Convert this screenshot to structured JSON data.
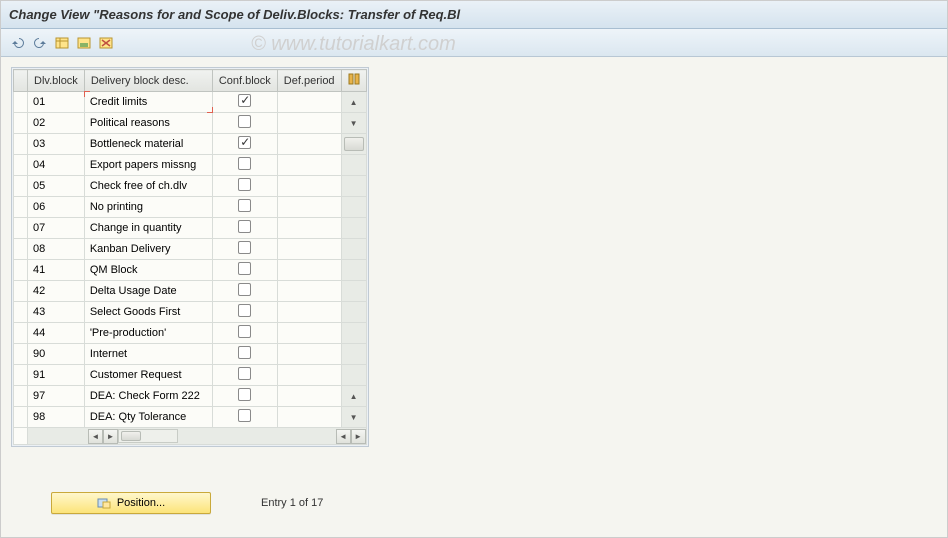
{
  "title": "Change View \"Reasons for and Scope of Deliv.Blocks: Transfer of Req.Bl",
  "watermark": "© www.tutorialkart.com",
  "toolbar": {
    "icons": [
      "undo-icon",
      "redo-icon",
      "table-new-icon",
      "table-save-icon",
      "table-delete-icon"
    ]
  },
  "columns": {
    "dlv": "Dlv.block",
    "desc": "Delivery block desc.",
    "conf": "Conf.block",
    "def": "Def.period"
  },
  "rows": [
    {
      "dlv": "01",
      "desc": "Credit limits",
      "conf": true,
      "def": ""
    },
    {
      "dlv": "02",
      "desc": "Political reasons",
      "conf": false,
      "def": ""
    },
    {
      "dlv": "03",
      "desc": "Bottleneck material",
      "conf": true,
      "def": ""
    },
    {
      "dlv": "04",
      "desc": "Export papers missng",
      "conf": false,
      "def": ""
    },
    {
      "dlv": "05",
      "desc": "Check free of ch.dlv",
      "conf": false,
      "def": ""
    },
    {
      "dlv": "06",
      "desc": "No printing",
      "conf": false,
      "def": ""
    },
    {
      "dlv": "07",
      "desc": "Change in quantity",
      "conf": false,
      "def": ""
    },
    {
      "dlv": "08",
      "desc": "Kanban Delivery",
      "conf": false,
      "def": ""
    },
    {
      "dlv": "41",
      "desc": "QM Block",
      "conf": false,
      "def": ""
    },
    {
      "dlv": "42",
      "desc": "Delta Usage Date",
      "conf": false,
      "def": ""
    },
    {
      "dlv": "43",
      "desc": "Select Goods First",
      "conf": false,
      "def": ""
    },
    {
      "dlv": "44",
      "desc": "'Pre-production'",
      "conf": false,
      "def": ""
    },
    {
      "dlv": "90",
      "desc": "Internet",
      "conf": false,
      "def": ""
    },
    {
      "dlv": "91",
      "desc": "Customer Request",
      "conf": false,
      "def": ""
    },
    {
      "dlv": "97",
      "desc": "DEA: Check Form 222",
      "conf": false,
      "def": ""
    },
    {
      "dlv": "98",
      "desc": "DEA: Qty Tolerance",
      "conf": false,
      "def": ""
    }
  ],
  "footer": {
    "position_label": "Position...",
    "entry_text": "Entry 1 of 17"
  }
}
